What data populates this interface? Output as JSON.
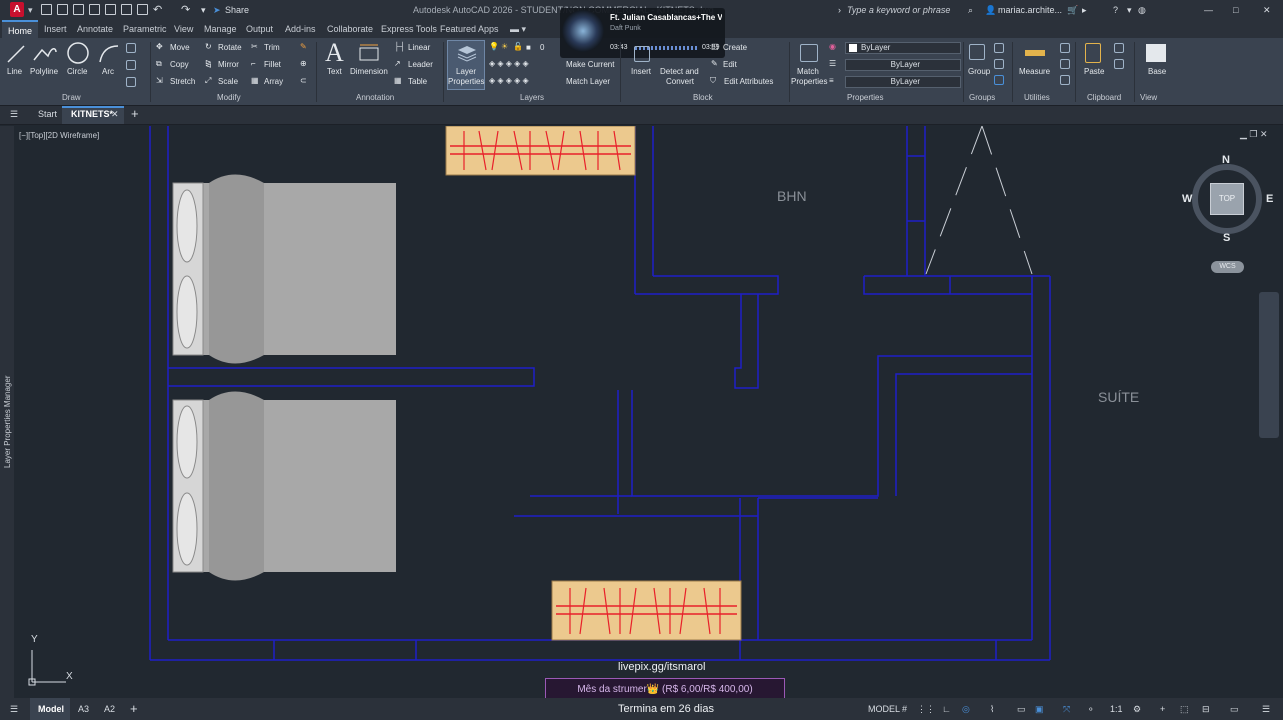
{
  "titlebar": {
    "app_letter": "A",
    "share_label": "Share",
    "title": "Autodesk AutoCAD 2026 - STUDENT/NON COMMERCIAL - KITNETS.dwg",
    "search_placeholder": "Type a keyword or phrase",
    "user": "mariac.archite..."
  },
  "music": {
    "track": "Ft. Julian Casablancas+The V",
    "artist": "Daft Punk",
    "elapsed": "03:43",
    "duration": "03:59"
  },
  "ribbon_tabs": [
    "Home",
    "Insert",
    "Annotate",
    "Parametric",
    "View",
    "Manage",
    "Output",
    "Add-ins",
    "Collaborate",
    "Express Tools",
    "Featured Apps"
  ],
  "ribbon": {
    "draw": {
      "title": "Draw",
      "line": "Line",
      "polyline": "Polyline",
      "circle": "Circle",
      "arc": "Arc"
    },
    "modify": {
      "title": "Modify",
      "move": "Move",
      "rotate": "Rotate",
      "trim": "Trim",
      "copy": "Copy",
      "mirror": "Mirror",
      "fillet": "Fillet",
      "stretch": "Stretch",
      "scale": "Scale",
      "array": "Array"
    },
    "annotation": {
      "title": "Annotation",
      "text": "Text",
      "dimension": "Dimension",
      "linear": "Linear",
      "leader": "Leader",
      "table": "Table"
    },
    "layers": {
      "title": "Layers",
      "layer_properties_1": "Layer",
      "layer_properties_2": "Properties",
      "current_layer": "0",
      "make_current": "Make Current",
      "match_layer": "Match Layer"
    },
    "block": {
      "title": "Block",
      "insert": "Insert",
      "create": "Create",
      "edit": "Edit",
      "detect_1": "Detect and",
      "detect_2": "Convert",
      "edit_attributes": "Edit Attributes"
    },
    "properties": {
      "title": "Properties",
      "match_1": "Match",
      "match_2": "Properties",
      "color": "ByLayer",
      "linetype": "ByLayer",
      "lineweight": "ByLayer"
    },
    "groups": {
      "title": "Groups",
      "group": "Group"
    },
    "utilities": {
      "title": "Utilities",
      "measure": "Measure"
    },
    "clipboard": {
      "title": "Clipboard",
      "paste": "Paste"
    },
    "view": {
      "title": "View",
      "base": "Base"
    }
  },
  "file_tabs": {
    "start": "Start",
    "current": "KITNETS*"
  },
  "viewport": {
    "label": "[−][Top][2D Wireframe]"
  },
  "sidebar": {
    "label": "Layer Properties Manager"
  },
  "drawing": {
    "room_bhn": "BHN",
    "room_suite": "SUÍTE"
  },
  "viewcube": {
    "north": "N",
    "south": "S",
    "east": "E",
    "west": "W",
    "top": "TOP",
    "wcs": "WCS"
  },
  "ucs": {
    "y": "Y",
    "x": "X"
  },
  "status": {
    "model_tab": "Model",
    "layout_1": "A3",
    "layout_2": "A2",
    "model_label": "MODEL",
    "scale": "1:1"
  },
  "overlay": {
    "link": "livepix.gg/itsmarol",
    "donation": "Mês da strumer👑 (R$ 6,00/R$ 400,00)",
    "ends": "Termina em 26 dias"
  },
  "colors": {
    "wall_blue": "#1f1fc8",
    "furniture_fill": "#a8a8a8",
    "cabinet_fill": "#ecc98e",
    "cabinet_red": "#e8202a",
    "accent": "#4a90d9"
  }
}
